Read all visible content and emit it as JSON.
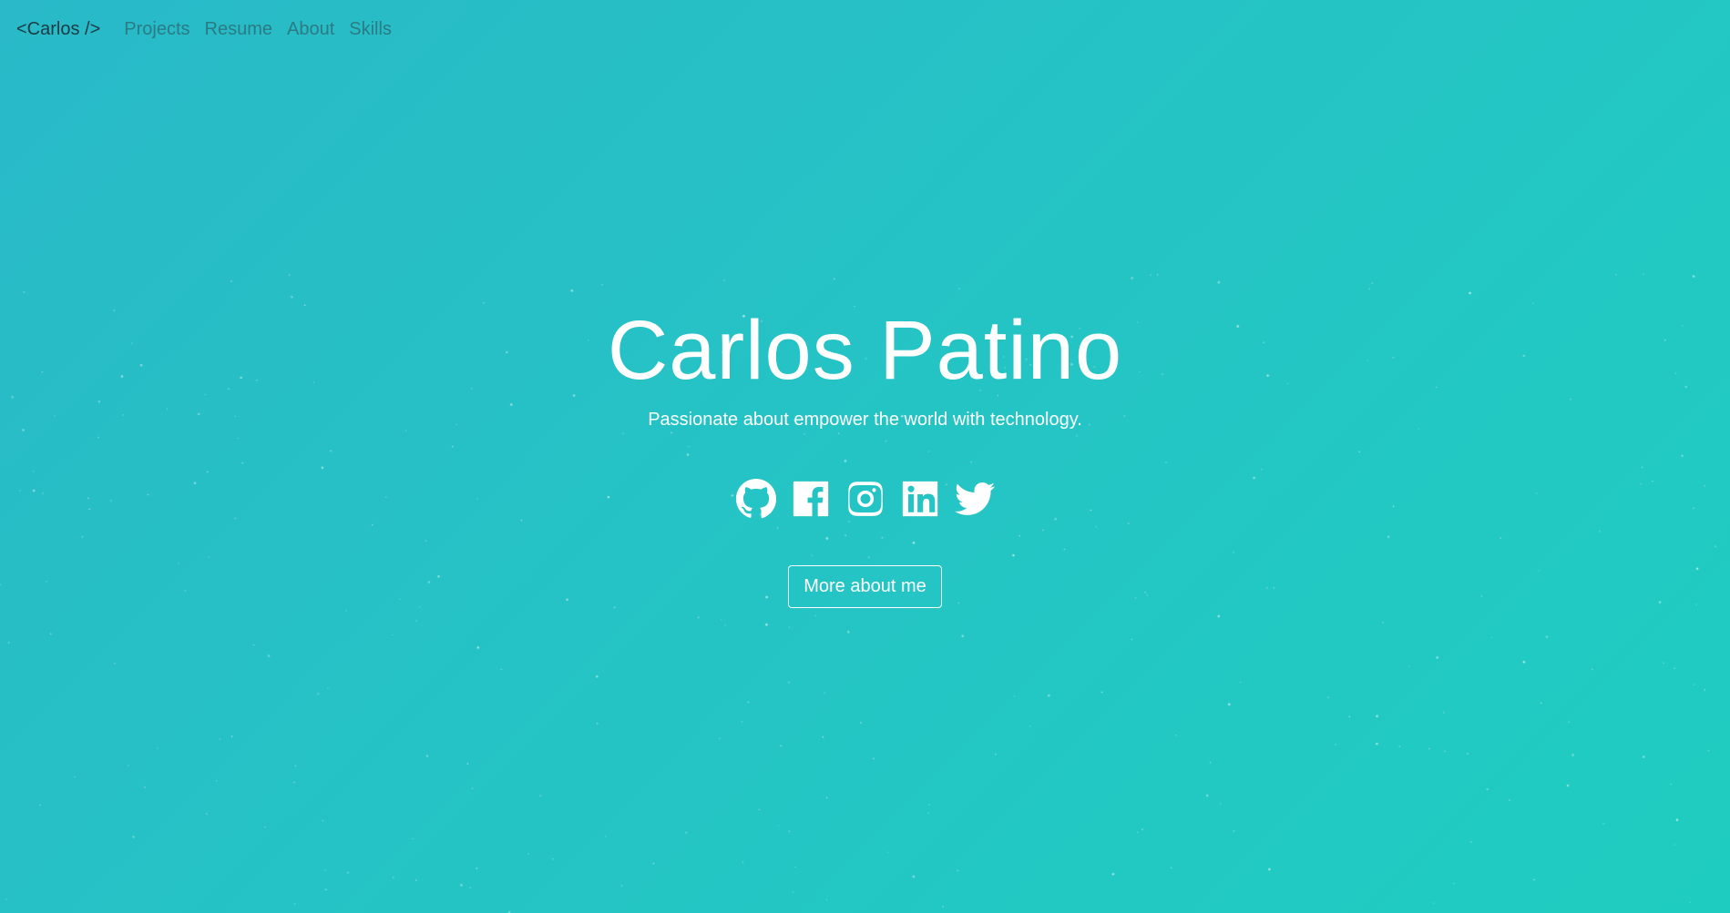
{
  "nav": {
    "brand": "<Carlos />",
    "links": [
      "Projects",
      "Resume",
      "About",
      "Skills"
    ]
  },
  "hero": {
    "title": "Carlos Patino",
    "subtitle": "Passionate about empower the world with technology.",
    "button_label": "More about me"
  },
  "socials": [
    {
      "name": "github",
      "icon": "github-icon"
    },
    {
      "name": "facebook",
      "icon": "facebook-icon"
    },
    {
      "name": "instagram",
      "icon": "instagram-icon"
    },
    {
      "name": "linkedin",
      "icon": "linkedin-icon"
    },
    {
      "name": "twitter",
      "icon": "twitter-icon"
    }
  ],
  "colors": {
    "background_start": "#29b9c8",
    "background_end": "#1fcdc0",
    "text": "#ffffff",
    "brand": "#1b3b44",
    "nav_link": "#2a7b84"
  }
}
